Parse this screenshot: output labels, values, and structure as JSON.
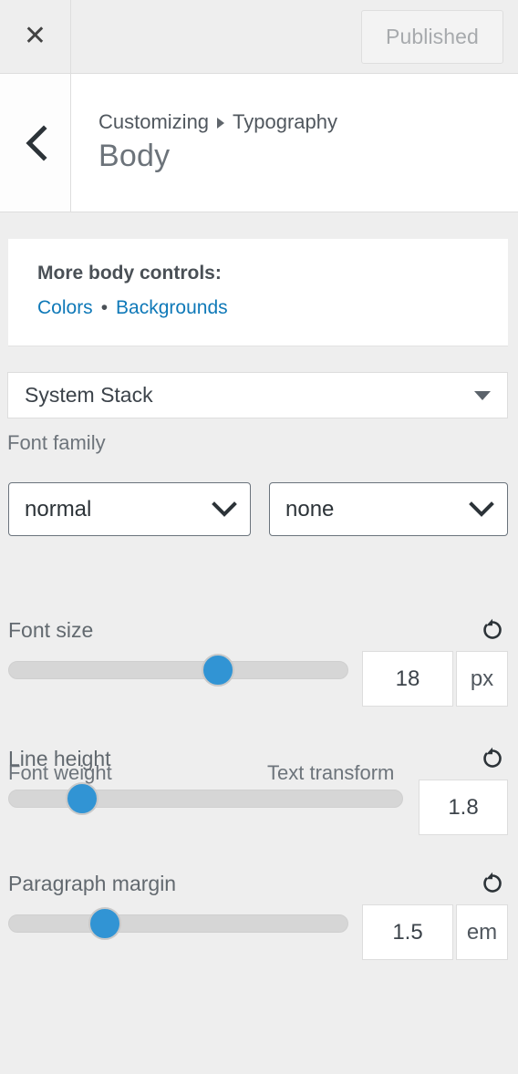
{
  "topbar": {
    "close_label": "✕",
    "close_icon": "close-icon",
    "publish_label": "Published"
  },
  "panel": {
    "back_icon": "chevron-left-icon",
    "breadcrumb": {
      "root": "Customizing",
      "separator": "▸",
      "current": "Typography"
    },
    "title": "Body"
  },
  "more_controls": {
    "title": "More body controls:",
    "links": [
      {
        "label": "Colors"
      },
      {
        "label": "Backgrounds"
      }
    ],
    "separator": "•"
  },
  "font_family": {
    "value": "System Stack",
    "label": "Font family",
    "caret_icon": "triangle-down-icon"
  },
  "font_weight": {
    "value": "normal",
    "label": "Font weight",
    "caret_icon": "chevron-down-icon"
  },
  "text_transform": {
    "value": "none",
    "label": "Text transform",
    "caret_icon": "chevron-down-icon"
  },
  "sliders": [
    {
      "label": "Font size",
      "value": "18",
      "unit": "px",
      "reset_icon": "reset-icon",
      "percent": 52
    },
    {
      "label": "Line height",
      "value": "1.8",
      "unit": "",
      "reset_icon": "reset-icon",
      "percent": 19
    },
    {
      "label": "Paragraph margin",
      "value": "1.5",
      "unit": "em",
      "reset_icon": "reset-icon",
      "percent": 28
    }
  ],
  "colors": {
    "accent": "#3194d4",
    "link": "#0f79b8",
    "page_bg": "#eeeeee",
    "panel_bg": "#ffffff",
    "border": "#dddddd",
    "text": "#50575e"
  }
}
